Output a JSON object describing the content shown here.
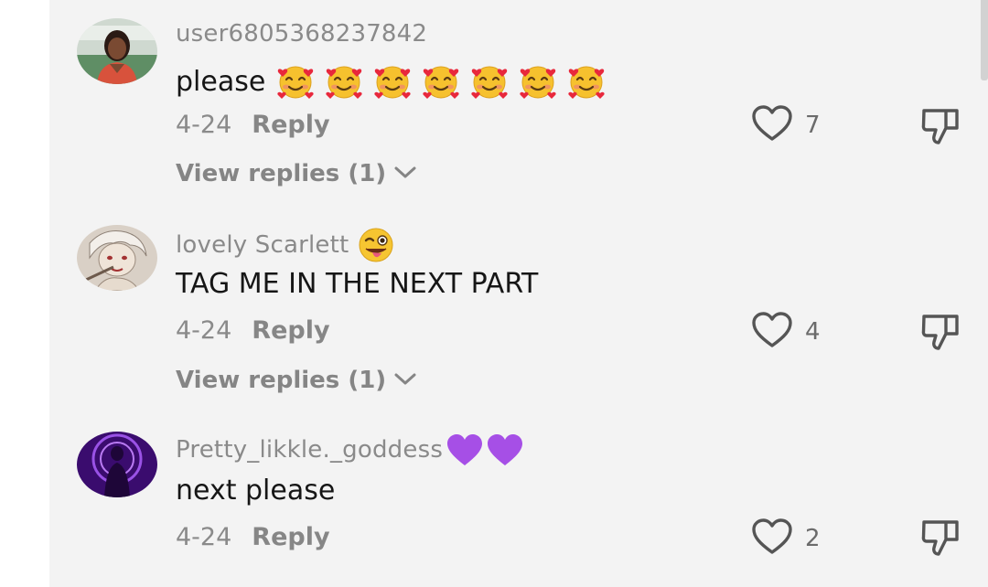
{
  "comments": [
    {
      "username": "user6805368237842",
      "text": "please",
      "emoji_count": 7,
      "emoji_name": "smiling-face-with-hearts",
      "date": "4-24",
      "reply_label": "Reply",
      "view_replies": "View replies (1)",
      "likes": "7"
    },
    {
      "username": "lovely Scarlett",
      "username_emoji": "winking-face-with-tongue",
      "text": "TAG ME IN THE NEXT PART",
      "date": "4-24",
      "reply_label": "Reply",
      "view_replies": "View replies (1)",
      "likes": "4"
    },
    {
      "username": "Pretty_likkle._goddess",
      "username_emoji": "purple-heart",
      "username_emoji_count": 2,
      "text": "next please",
      "date": "4-24",
      "reply_label": "Reply",
      "likes": "2"
    }
  ],
  "colors": {
    "background": "#f3f3f3",
    "username": "#8a8a8a",
    "comment_text": "#161616",
    "purple_heart": "#a64fe6"
  }
}
